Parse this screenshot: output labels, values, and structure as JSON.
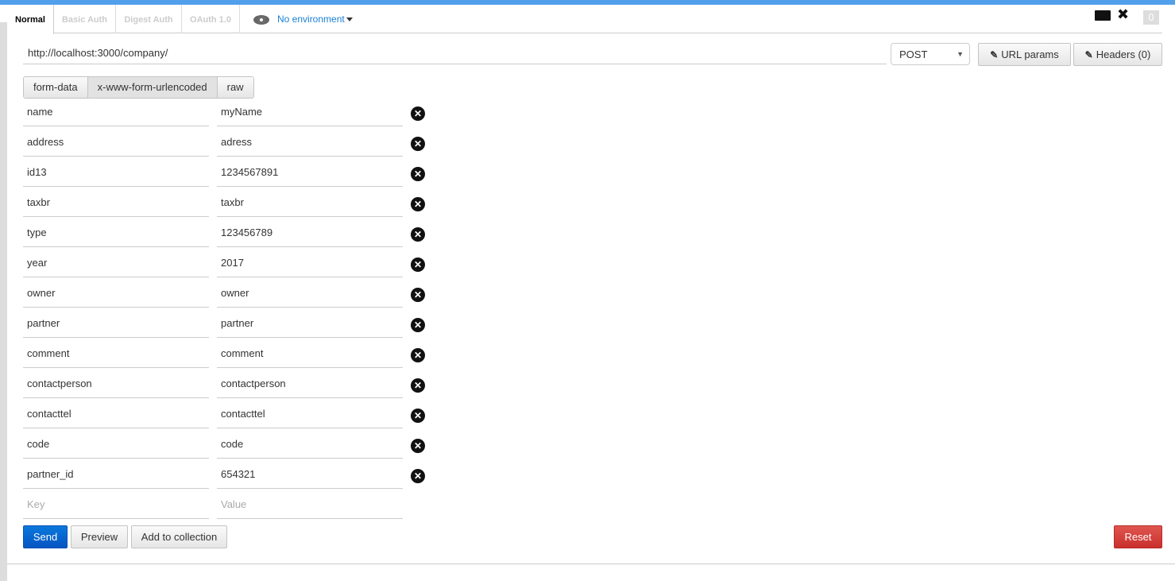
{
  "tabs": [
    "Normal",
    "Basic Auth",
    "Digest Auth",
    "OAuth 1.0"
  ],
  "environment": "No environment",
  "notification_count": "0",
  "url": "http://localhost:3000/company/",
  "method": "POST",
  "url_params_label": "URL params",
  "headers_label": "Headers (0)",
  "body_types": [
    "form-data",
    "x-www-form-urlencoded",
    "raw"
  ],
  "selected_body_type": "x-www-form-urlencoded",
  "params": [
    {
      "key": "name",
      "value": "myName"
    },
    {
      "key": "address",
      "value": "adress"
    },
    {
      "key": "id13",
      "value": "1234567891"
    },
    {
      "key": "taxbr",
      "value": "taxbr"
    },
    {
      "key": "type",
      "value": "123456789"
    },
    {
      "key": "year",
      "value": "2017"
    },
    {
      "key": "owner",
      "value": "owner"
    },
    {
      "key": "partner",
      "value": "partner"
    },
    {
      "key": "comment",
      "value": "comment"
    },
    {
      "key": "contactperson",
      "value": "contactperson"
    },
    {
      "key": "contacttel",
      "value": "contacttel"
    },
    {
      "key": "code",
      "value": "code"
    },
    {
      "key": "partner_id",
      "value": "654321"
    }
  ],
  "new_param": {
    "key_placeholder": "Key",
    "value_placeholder": "Value"
  },
  "actions": {
    "send": "Send",
    "preview": "Preview",
    "add": "Add to collection",
    "reset": "Reset"
  },
  "colors": {
    "accent": "#52a0ec",
    "send": "#0a6fd6",
    "reset": "#d9433e",
    "link": "#1a7fd4"
  }
}
